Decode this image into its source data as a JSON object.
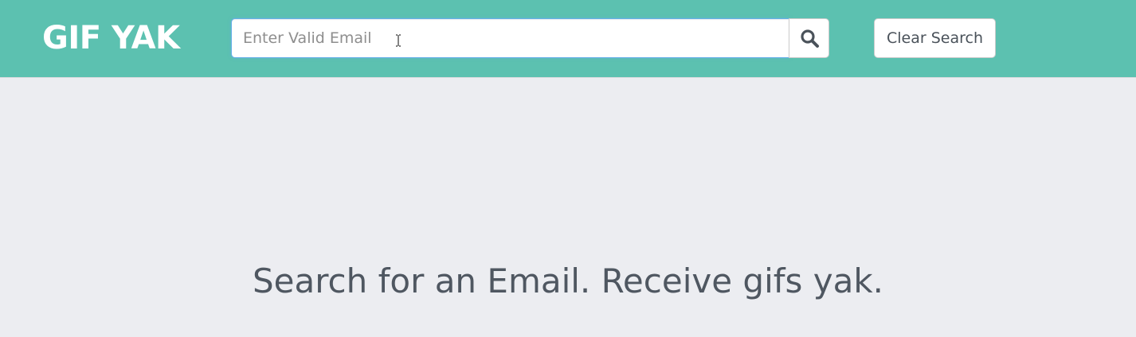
{
  "header": {
    "logo": "GIF YAK",
    "background_color": "#5cc1b0"
  },
  "search": {
    "placeholder": "Enter Valid Email",
    "value": "",
    "button_icon": "search-icon",
    "clear_label": "Clear Search"
  },
  "main": {
    "tagline": "Search for an Email. Receive gifs yak.",
    "background_color": "#ecedf1",
    "text_color": "#4f5761"
  }
}
